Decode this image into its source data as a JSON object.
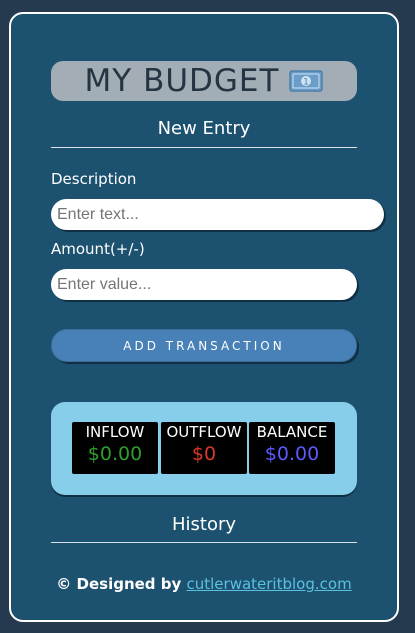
{
  "app": {
    "title": "MY BUDGET"
  },
  "new_entry": {
    "heading": "New Entry",
    "description_label": "Description",
    "description_placeholder": "Enter text...",
    "amount_label": "Amount(+/-)",
    "amount_placeholder": "Enter value...",
    "add_button_label": "ADD TRANSACTION"
  },
  "summary": {
    "inflow": {
      "label": "INFLOW",
      "value": "$0.00",
      "color": "#2e9e2e"
    },
    "outflow": {
      "label": "OUTFLOW",
      "value": "$0",
      "color": "#d83a2a"
    },
    "balance": {
      "label": "BALANCE",
      "value": "$0.00",
      "color": "#5a5aff"
    }
  },
  "history": {
    "heading": "History"
  },
  "footer": {
    "prefix": "© Designed by ",
    "link_text": "cutlerwateritblog.com"
  },
  "colors": {
    "background": "#263a4f",
    "card": "#1d5170",
    "button": "#4880b8",
    "summary_panel": "#87ceeb",
    "link": "#5bc0de"
  },
  "icons": {
    "title_icon": "money-bill-icon"
  }
}
